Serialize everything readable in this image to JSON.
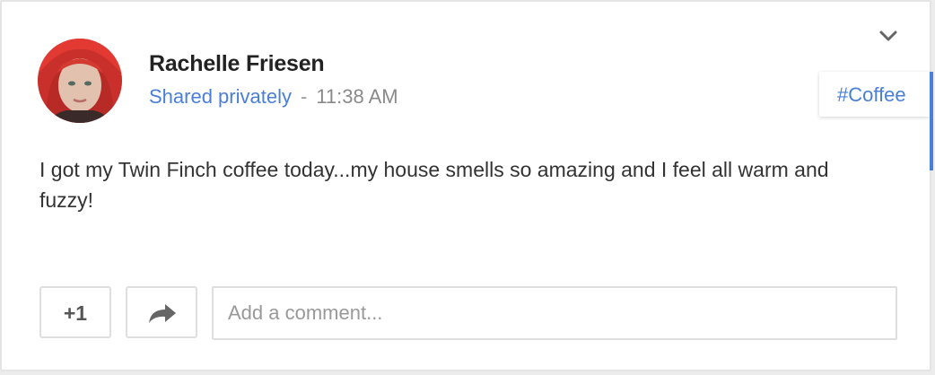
{
  "post": {
    "author_name": "Rachelle Friesen",
    "visibility": "Shared privately",
    "separator": "-",
    "timestamp": "11:38 AM",
    "body": "I got my Twin Finch coffee today...my house smells so amazing and I feel all warm and fuzzy!",
    "hashtag": "#Coffee"
  },
  "actions": {
    "plus_one_label": "+1",
    "share_icon": "share-arrow-icon",
    "comment_placeholder": "Add a comment..."
  },
  "menu": {
    "icon": "chevron-down-icon"
  },
  "colors": {
    "link_blue": "#4a7fd8",
    "author_text": "#222222",
    "meta_gray": "#8a8a8a",
    "border": "#dedede"
  }
}
